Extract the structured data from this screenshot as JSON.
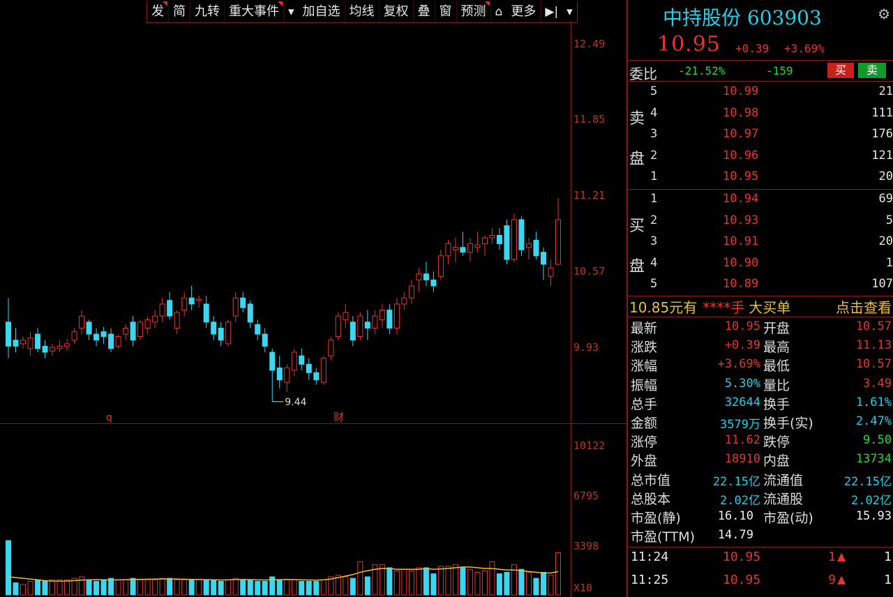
{
  "toolbar": {
    "items": [
      {
        "label": "发",
        "flag": true
      },
      {
        "label": "简",
        "flag": false
      },
      {
        "label": "九转",
        "flag": false
      },
      {
        "label": "重大事件",
        "flag": true
      },
      {
        "label": "加自选",
        "flag": false
      },
      {
        "label": "均线",
        "flag": false
      },
      {
        "label": "复权",
        "flag": false
      },
      {
        "label": "叠",
        "flag": false
      },
      {
        "label": "窗",
        "flag": false
      },
      {
        "label": "预测",
        "flag": true
      },
      {
        "label": "🔒",
        "flag": false
      },
      {
        "label": "更多",
        "flag": false
      }
    ],
    "icons": [
      "dropdown-arrow-icon",
      "lock-icon",
      "sidebar-toggle-icon",
      "chevron-down-icon"
    ]
  },
  "chart_data": {
    "type": "candlestick",
    "price_axis_ticks": [
      "12.49",
      "11.85",
      "11.21",
      "10.57",
      "9.93"
    ],
    "volume_axis_ticks": [
      "10122",
      "6795",
      "3398",
      "X10"
    ],
    "min_marker_label": "9.44",
    "event_markers": [
      "q",
      "财"
    ],
    "price_ylim": [
      9.3,
      12.6
    ],
    "volume_ylim": [
      0,
      11000
    ],
    "candles": [
      [
        10.1,
        10.3,
        9.8,
        9.9
      ],
      [
        9.95,
        10.05,
        9.85,
        9.9
      ],
      [
        9.92,
        9.98,
        9.88,
        9.95
      ],
      [
        9.88,
        10.02,
        9.82,
        9.97
      ],
      [
        10.0,
        10.05,
        9.85,
        9.88
      ],
      [
        9.9,
        9.95,
        9.8,
        9.85
      ],
      [
        9.86,
        9.92,
        9.82,
        9.89
      ],
      [
        9.88,
        9.95,
        9.85,
        9.9
      ],
      [
        9.9,
        9.96,
        9.86,
        9.92
      ],
      [
        9.95,
        10.05,
        9.92,
        10.02
      ],
      [
        10.05,
        10.2,
        10.0,
        10.15
      ],
      [
        10.1,
        10.12,
        9.95,
        10.0
      ],
      [
        10.0,
        10.05,
        9.9,
        9.95
      ],
      [
        10.02,
        10.06,
        9.92,
        9.98
      ],
      [
        10.0,
        10.05,
        9.85,
        9.88
      ],
      [
        9.9,
        10.0,
        9.88,
        9.98
      ],
      [
        10.0,
        10.08,
        9.95,
        10.05
      ],
      [
        10.1,
        10.15,
        9.9,
        9.95
      ],
      [
        9.98,
        10.12,
        9.95,
        10.1
      ],
      [
        10.05,
        10.15,
        10.0,
        10.12
      ],
      [
        10.1,
        10.2,
        10.05,
        10.15
      ],
      [
        10.15,
        10.3,
        10.1,
        10.25
      ],
      [
        10.28,
        10.35,
        10.12,
        10.15
      ],
      [
        10.05,
        10.2,
        10.0,
        10.18
      ],
      [
        10.2,
        10.35,
        10.15,
        10.3
      ],
      [
        10.3,
        10.4,
        10.2,
        10.25
      ],
      [
        10.28,
        10.32,
        10.22,
        10.29
      ],
      [
        10.25,
        10.32,
        10.05,
        10.1
      ],
      [
        10.1,
        10.15,
        9.95,
        10.0
      ],
      [
        10.05,
        10.1,
        9.9,
        9.95
      ],
      [
        9.92,
        10.12,
        9.9,
        10.1
      ],
      [
        10.15,
        10.35,
        10.1,
        10.3
      ],
      [
        10.3,
        10.35,
        10.18,
        10.22
      ],
      [
        10.25,
        10.28,
        10.05,
        10.1
      ],
      [
        10.08,
        10.12,
        9.95,
        10.0
      ],
      [
        10.0,
        10.05,
        9.85,
        9.9
      ],
      [
        9.85,
        9.88,
        9.44,
        9.7
      ],
      [
        9.72,
        9.82,
        9.55,
        9.62
      ],
      [
        9.6,
        9.75,
        9.52,
        9.72
      ],
      [
        9.7,
        9.88,
        9.65,
        9.85
      ],
      [
        9.82,
        9.88,
        9.7,
        9.75
      ],
      [
        9.75,
        9.8,
        9.62,
        9.68
      ],
      [
        9.68,
        9.72,
        9.58,
        9.62
      ],
      [
        9.6,
        9.82,
        9.58,
        9.8
      ],
      [
        9.82,
        9.98,
        9.78,
        9.95
      ],
      [
        9.98,
        10.18,
        9.95,
        10.15
      ],
      [
        10.12,
        10.25,
        10.05,
        10.18
      ],
      [
        10.1,
        10.15,
        9.9,
        9.95
      ],
      [
        9.98,
        10.18,
        9.95,
        10.15
      ],
      [
        10.1,
        10.2,
        9.95,
        10.05
      ],
      [
        10.05,
        10.2,
        10.0,
        10.15
      ],
      [
        10.12,
        10.25,
        10.05,
        10.2
      ],
      [
        10.2,
        10.25,
        10.0,
        10.05
      ],
      [
        10.05,
        10.3,
        10.0,
        10.25
      ],
      [
        10.25,
        10.35,
        10.2,
        10.3
      ],
      [
        10.3,
        10.45,
        10.25,
        10.4
      ],
      [
        10.45,
        10.55,
        10.35,
        10.5
      ],
      [
        10.5,
        10.6,
        10.4,
        10.45
      ],
      [
        10.45,
        10.52,
        10.35,
        10.4
      ],
      [
        10.48,
        10.7,
        10.45,
        10.65
      ],
      [
        10.65,
        10.78,
        10.58,
        10.75
      ],
      [
        10.7,
        10.8,
        10.6,
        10.72
      ],
      [
        10.72,
        10.85,
        10.65,
        10.68
      ],
      [
        10.68,
        10.8,
        10.6,
        10.75
      ],
      [
        10.72,
        10.85,
        10.68,
        10.74
      ],
      [
        10.75,
        10.82,
        10.65,
        10.8
      ],
      [
        10.8,
        10.88,
        10.75,
        10.82
      ],
      [
        10.82,
        10.88,
        10.7,
        10.75
      ],
      [
        10.9,
        10.95,
        10.58,
        10.62
      ],
      [
        10.62,
        11.0,
        10.6,
        10.95
      ],
      [
        10.95,
        10.98,
        10.65,
        10.7
      ],
      [
        10.72,
        10.8,
        10.62,
        10.75
      ],
      [
        10.78,
        10.85,
        10.62,
        10.65
      ],
      [
        10.68,
        10.72,
        10.45,
        10.58
      ],
      [
        10.48,
        10.62,
        10.4,
        10.55
      ],
      [
        10.58,
        11.13,
        10.57,
        10.95
      ]
    ],
    "volume_red_idx_ratio": "per-candle",
    "volumes": [
      3600,
      800,
      700,
      900,
      1000,
      900,
      1000,
      1000,
      1000,
      1100,
      1200,
      1000,
      900,
      1000,
      1100,
      1000,
      1000,
      1100,
      1000,
      1000,
      1000,
      1100,
      1100,
      1000,
      1000,
      1000,
      1000,
      1000,
      1000,
      900,
      1000,
      1100,
      1000,
      1000,
      900,
      900,
      1200,
      1000,
      1000,
      1000,
      900,
      900,
      900,
      1000,
      1200,
      1300,
      1200,
      1100,
      2200,
      1200,
      2000,
      2000,
      1800,
      1600,
      1700,
      1600,
      1800,
      1800,
      1400,
      1900,
      1900,
      2000,
      1800,
      1700,
      1500,
      1600,
      2200,
      1400,
      1500,
      2000,
      1700,
      1500,
      1100,
      1500,
      1300,
      2800
    ],
    "ma5": [
      1200,
      1150,
      1100,
      1050,
      1000,
      950,
      920,
      910,
      920,
      950,
      980,
      1000,
      1010,
      1000,
      990,
      1000,
      1010,
      1020,
      1030,
      1040,
      1050,
      1060,
      1060,
      1050,
      1040,
      1030,
      1020,
      1010,
      1000,
      990,
      1000,
      1010,
      1020,
      1010,
      1000,
      990,
      1000,
      1010,
      1020,
      1010,
      1000,
      990,
      980,
      1000,
      1050,
      1150,
      1250,
      1350,
      1500,
      1600,
      1700,
      1750,
      1750,
      1700,
      1700,
      1700,
      1700,
      1750,
      1700,
      1720,
      1750,
      1800,
      1850,
      1850,
      1800,
      1750,
      1750,
      1700,
      1650,
      1650,
      1600,
      1550,
      1500,
      1450,
      1450,
      1550
    ]
  },
  "quote": {
    "name_code": "中持股份 603903",
    "price": "10.95",
    "change": "+0.39",
    "change_pct": "+3.69%",
    "weibi_label": "委比",
    "weibi": "-21.52%",
    "weicha": "-159",
    "buy_button": "买",
    "sell_button": "卖"
  },
  "orderbook": {
    "sell_label_1": "卖",
    "sell_label_2": "盘",
    "buy_label_1": "买",
    "buy_label_2": "盘",
    "asks": [
      {
        "level": "5",
        "price": "10.99",
        "qty": "21"
      },
      {
        "level": "4",
        "price": "10.98",
        "qty": "111"
      },
      {
        "level": "3",
        "price": "10.97",
        "qty": "176"
      },
      {
        "level": "2",
        "price": "10.96",
        "qty": "121"
      },
      {
        "level": "1",
        "price": "10.95",
        "qty": "20"
      }
    ],
    "bids": [
      {
        "level": "1",
        "price": "10.94",
        "qty": "69"
      },
      {
        "level": "2",
        "price": "10.93",
        "qty": "5"
      },
      {
        "level": "3",
        "price": "10.91",
        "qty": "20"
      },
      {
        "level": "4",
        "price": "10.90",
        "qty": "1"
      },
      {
        "level": "5",
        "price": "10.89",
        "qty": "107"
      }
    ]
  },
  "promo": {
    "a": "10.85元有",
    "b": "****手",
    "c": "大买单",
    "d": "点击查看"
  },
  "stats": [
    {
      "k1": "最新",
      "v1": "10.95",
      "c1": "red",
      "k2": "开盘",
      "v2": "10.57",
      "c2": "red"
    },
    {
      "k1": "涨跌",
      "v1": "+0.39",
      "c1": "red",
      "k2": "最高",
      "v2": "11.13",
      "c2": "red"
    },
    {
      "k1": "涨幅",
      "v1": "+3.69%",
      "c1": "red",
      "k2": "最低",
      "v2": "10.57",
      "c2": "red"
    },
    {
      "k1": "振幅",
      "v1": "5.30%",
      "c1": "cyan",
      "k2": "量比",
      "v2": "3.49",
      "c2": "red"
    },
    {
      "k1": "总手",
      "v1": "32644",
      "c1": "cyan",
      "k2": "换手",
      "v2": "1.61%",
      "c2": "cyan"
    },
    {
      "k1": "金额",
      "v1": "3579万",
      "c1": "cyan",
      "k2": "换手(实)",
      "v2": "2.47%",
      "c2": "cyan"
    },
    {
      "k1": "涨停",
      "v1": "11.62",
      "c1": "red",
      "k2": "跌停",
      "v2": "9.50",
      "c2": "green"
    },
    {
      "k1": "外盘",
      "v1": "18910",
      "c1": "red",
      "k2": "内盘",
      "v2": "13734",
      "c2": "green"
    },
    {
      "k1": "总市值",
      "v1": "22.15亿",
      "c1": "cyan",
      "k2": "流通值",
      "v2": "22.15亿",
      "c2": "cyan"
    },
    {
      "k1": "总股本",
      "v1": "2.02亿",
      "c1": "cyan",
      "k2": "流通股",
      "v2": "2.02亿",
      "c2": "cyan"
    },
    {
      "k1": "市盈(静)",
      "v1": "16.10",
      "c1": "white",
      "k2": "市盈(动)",
      "v2": "15.93",
      "c2": "white"
    },
    {
      "k1": "市盈(TTM)",
      "v1": "14.79",
      "c1": "white",
      "k2": "",
      "v2": "",
      "c2": "white"
    }
  ],
  "ticks": [
    {
      "time": "11:24",
      "price": "10.95",
      "vol": "1",
      "count": "1"
    },
    {
      "time": "11:25",
      "price": "10.95",
      "vol": "9",
      "count": "1"
    }
  ]
}
